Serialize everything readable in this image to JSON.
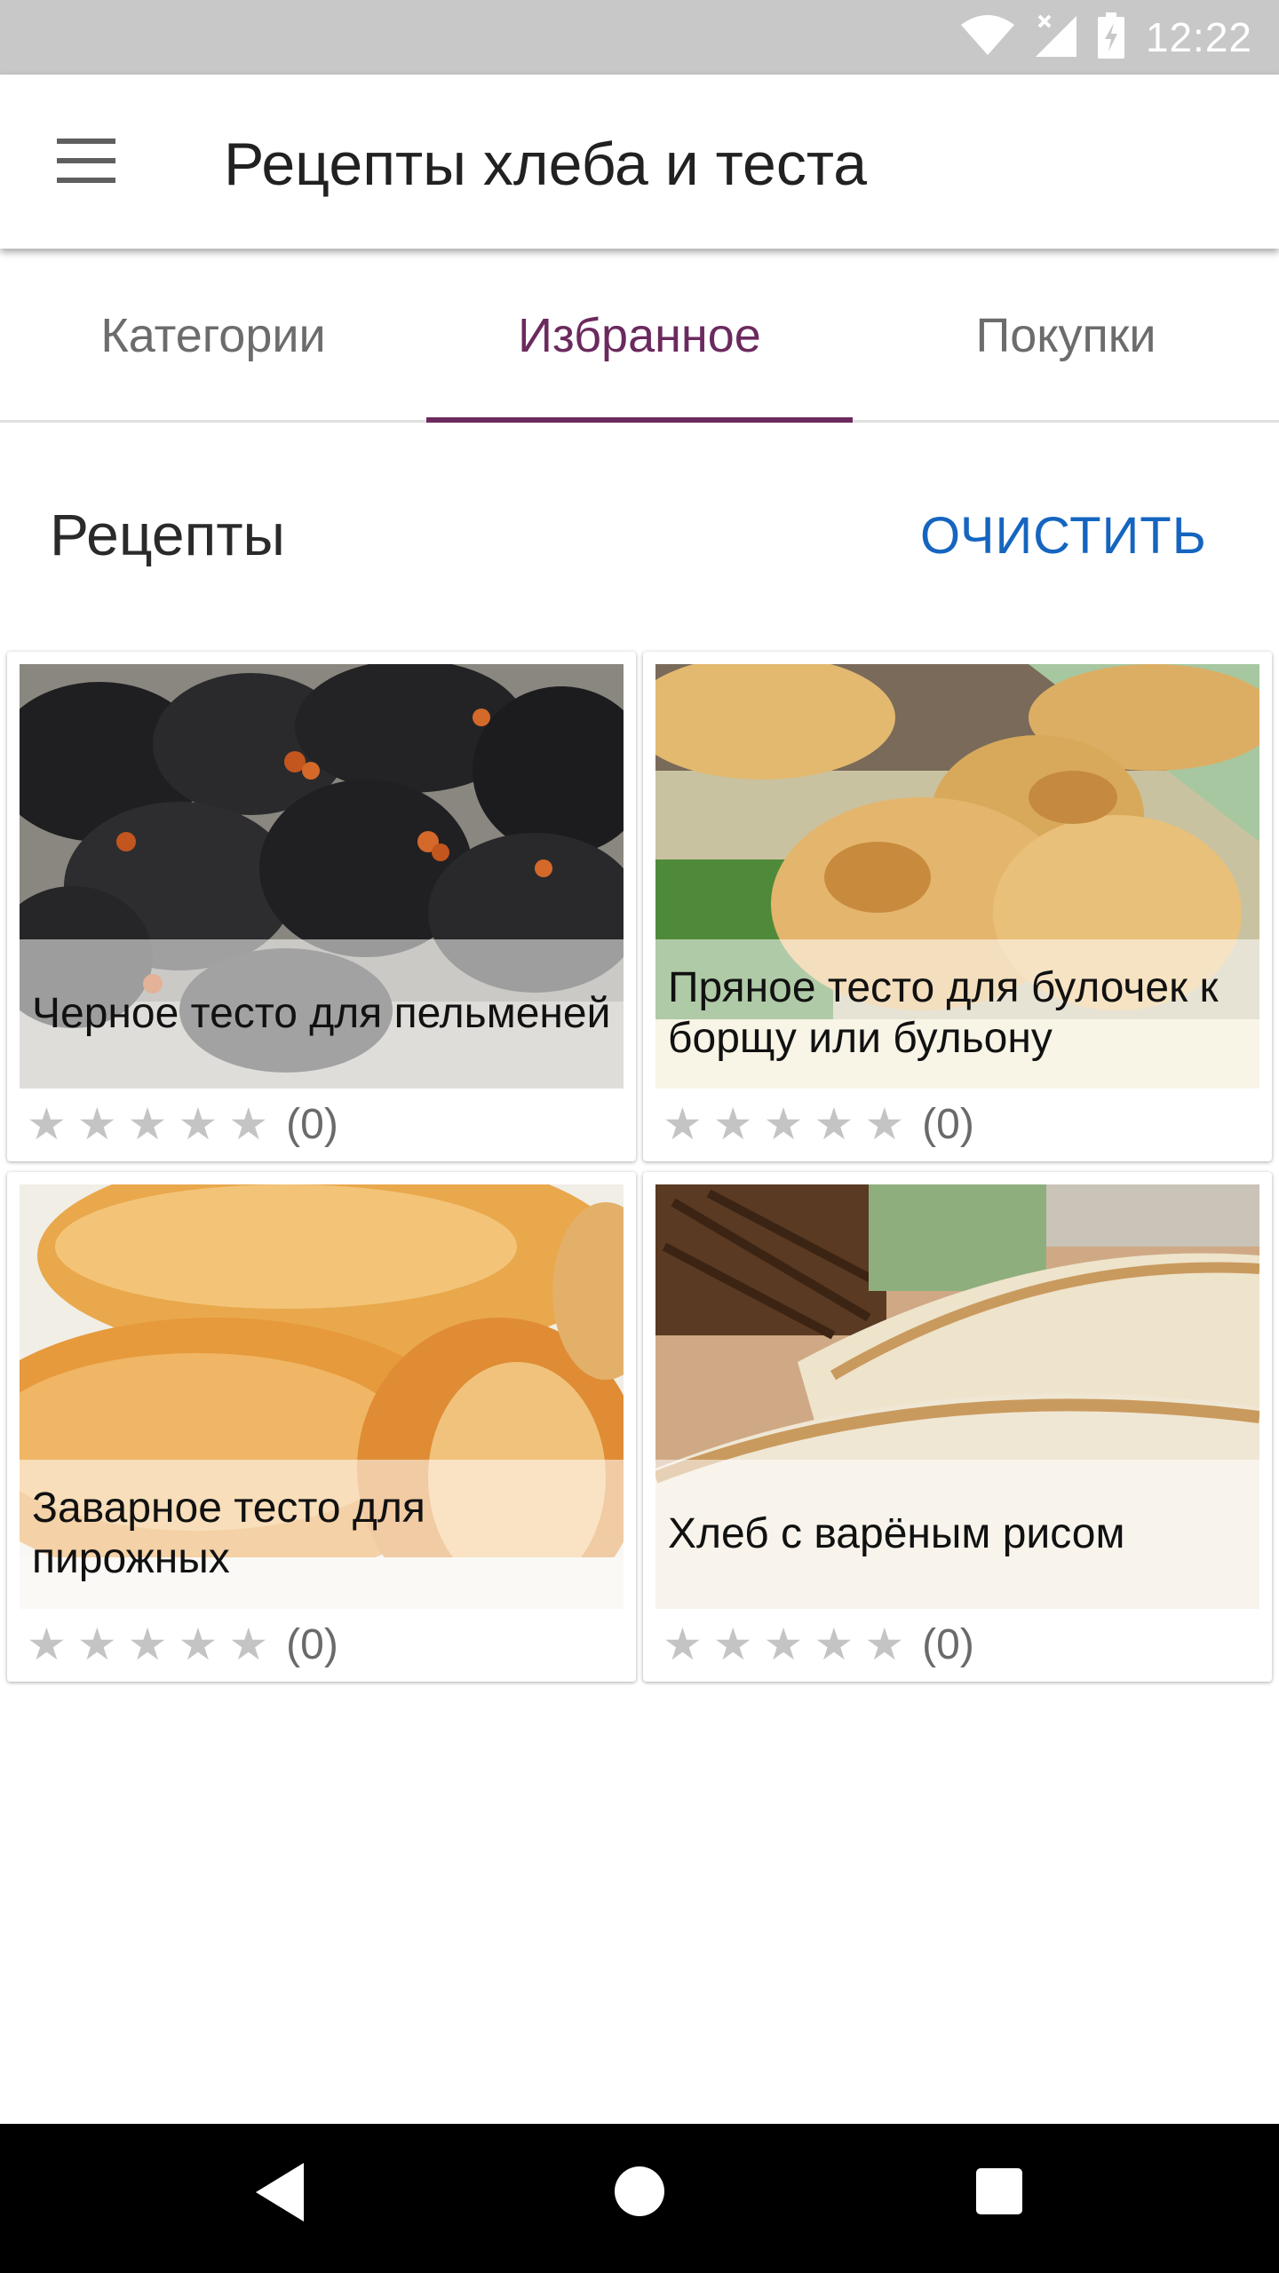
{
  "status_bar": {
    "time": "12:22",
    "icons": [
      "wifi-icon",
      "signal-icon",
      "battery-icon"
    ]
  },
  "app_bar": {
    "title": "Рецепты хлеба и теста",
    "menu_icon": "hamburger-menu-icon"
  },
  "tabs": [
    {
      "label": "Категории",
      "active": false
    },
    {
      "label": "Избранное",
      "active": true
    },
    {
      "label": "Покупки",
      "active": false
    }
  ],
  "section": {
    "title": "Рецепты",
    "action_label": "ОЧИСТИТЬ"
  },
  "recipes": [
    {
      "title": "Черное тесто для пельменей",
      "rating_stars": 0,
      "rating_count": "(0)"
    },
    {
      "title": "Пряное тесто для булочек к борщу или бульону",
      "rating_stars": 0,
      "rating_count": "(0)"
    },
    {
      "title": "Заварное тесто для пирожных",
      "rating_stars": 0,
      "rating_count": "(0)"
    },
    {
      "title": "Хлеб с варёным рисом",
      "rating_stars": 0,
      "rating_count": "(0)"
    }
  ],
  "star_glyph": "★",
  "colors": {
    "accent": "#6b2a5e",
    "action": "#1565c0",
    "status_bar": "#c8c8c8"
  },
  "nav_bar": {
    "icons": [
      "back-icon",
      "home-icon",
      "recents-icon"
    ]
  }
}
